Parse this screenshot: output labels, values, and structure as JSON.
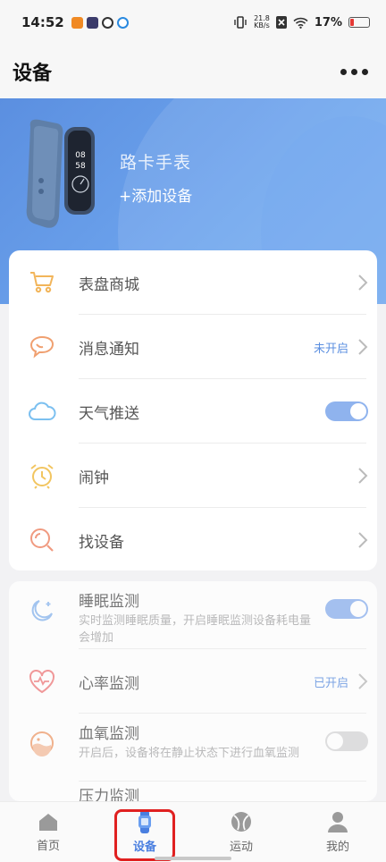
{
  "status_bar": {
    "time": "14:52",
    "speed_value": "21.8",
    "speed_unit": "KB/s",
    "battery": "17%"
  },
  "header": {
    "title": "设备"
  },
  "banner": {
    "device_name": "路卡手表",
    "add_device": "+添加设备",
    "watch_time_hour": "08",
    "watch_time_min": "58"
  },
  "settings": [
    {
      "label": "表盘商城",
      "icon": "cart-icon",
      "type": "chevron"
    },
    {
      "label": "消息通知",
      "icon": "message-icon",
      "type": "chevron",
      "status": "未开启"
    },
    {
      "label": "天气推送",
      "icon": "cloud-icon",
      "type": "toggle"
    },
    {
      "label": "闹钟",
      "icon": "alarm-clock-icon",
      "type": "chevron"
    },
    {
      "label": "找设备",
      "icon": "search-device-icon",
      "type": "chevron"
    }
  ],
  "monitoring": [
    {
      "label": "睡眠监测",
      "desc": "实时监测睡眠质量，开启睡眠监测设备耗电量会增加",
      "icon": "moon-icon",
      "type": "toggle"
    },
    {
      "label": "心率监测",
      "icon": "heart-rate-icon",
      "type": "chevron",
      "status": "已开启"
    },
    {
      "label": "血氧监测",
      "desc": "开启后，设备将在静止状态下进行血氧监测",
      "icon": "blood-oxygen-icon",
      "type": "toggle"
    },
    {
      "label": "压力监测"
    }
  ],
  "nav": [
    {
      "label": "首页",
      "icon": "home-icon"
    },
    {
      "label": "设备",
      "icon": "watch-icon"
    },
    {
      "label": "运动",
      "icon": "sport-ball-icon"
    },
    {
      "label": "我的",
      "icon": "user-icon"
    }
  ],
  "colors": {
    "accent": "#4a7fe0",
    "banner": "#5b8fe0",
    "highlight": "#e02020"
  }
}
